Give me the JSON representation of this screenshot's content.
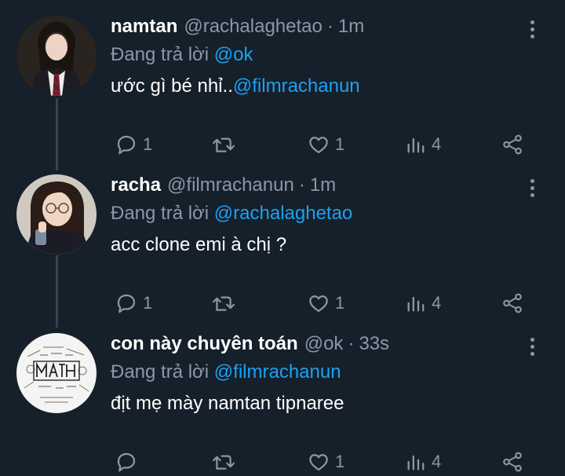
{
  "colors": {
    "background": "#15202b",
    "text_primary": "#ffffff",
    "text_secondary": "#8899a6",
    "accent": "#1da1f2",
    "thread_line": "#38444d"
  },
  "tweets": [
    {
      "name": "namtan",
      "handle": "@rachalaghetao",
      "dot": "·",
      "time": "1m",
      "replying_prefix": "Đang trả lời",
      "replying_to": "@ok",
      "text": "ước gì bé nhỉ..",
      "text_mention": "@filmrachanun",
      "reply_count": "1",
      "like_count": "1",
      "view_count": "4",
      "icons": [
        "reply-icon",
        "retweet-icon",
        "like-icon",
        "views-icon",
        "share-icon",
        "more-icon"
      ]
    },
    {
      "name": "racha",
      "handle": "@filmrachanun",
      "dot": "·",
      "time": "1m",
      "replying_prefix": "Đang trả lời",
      "replying_to": "@rachalaghetao",
      "text": "acc clone emi à chị ?",
      "reply_count": "1",
      "like_count": "1",
      "view_count": "4",
      "icons": [
        "reply-icon",
        "retweet-icon",
        "like-icon",
        "views-icon",
        "share-icon",
        "more-icon"
      ]
    },
    {
      "name": "con này chuyên toán",
      "handle": "@ok",
      "dot": "·",
      "time": "33s",
      "replying_prefix": "Đang trả lời",
      "replying_to": "@filmrachanun",
      "text": "địt mẹ mày namtan tipnaree",
      "reply_count": "",
      "like_count": "1",
      "view_count": "4",
      "icons": [
        "reply-icon",
        "retweet-icon",
        "like-icon",
        "views-icon",
        "share-icon",
        "more-icon"
      ]
    }
  ]
}
